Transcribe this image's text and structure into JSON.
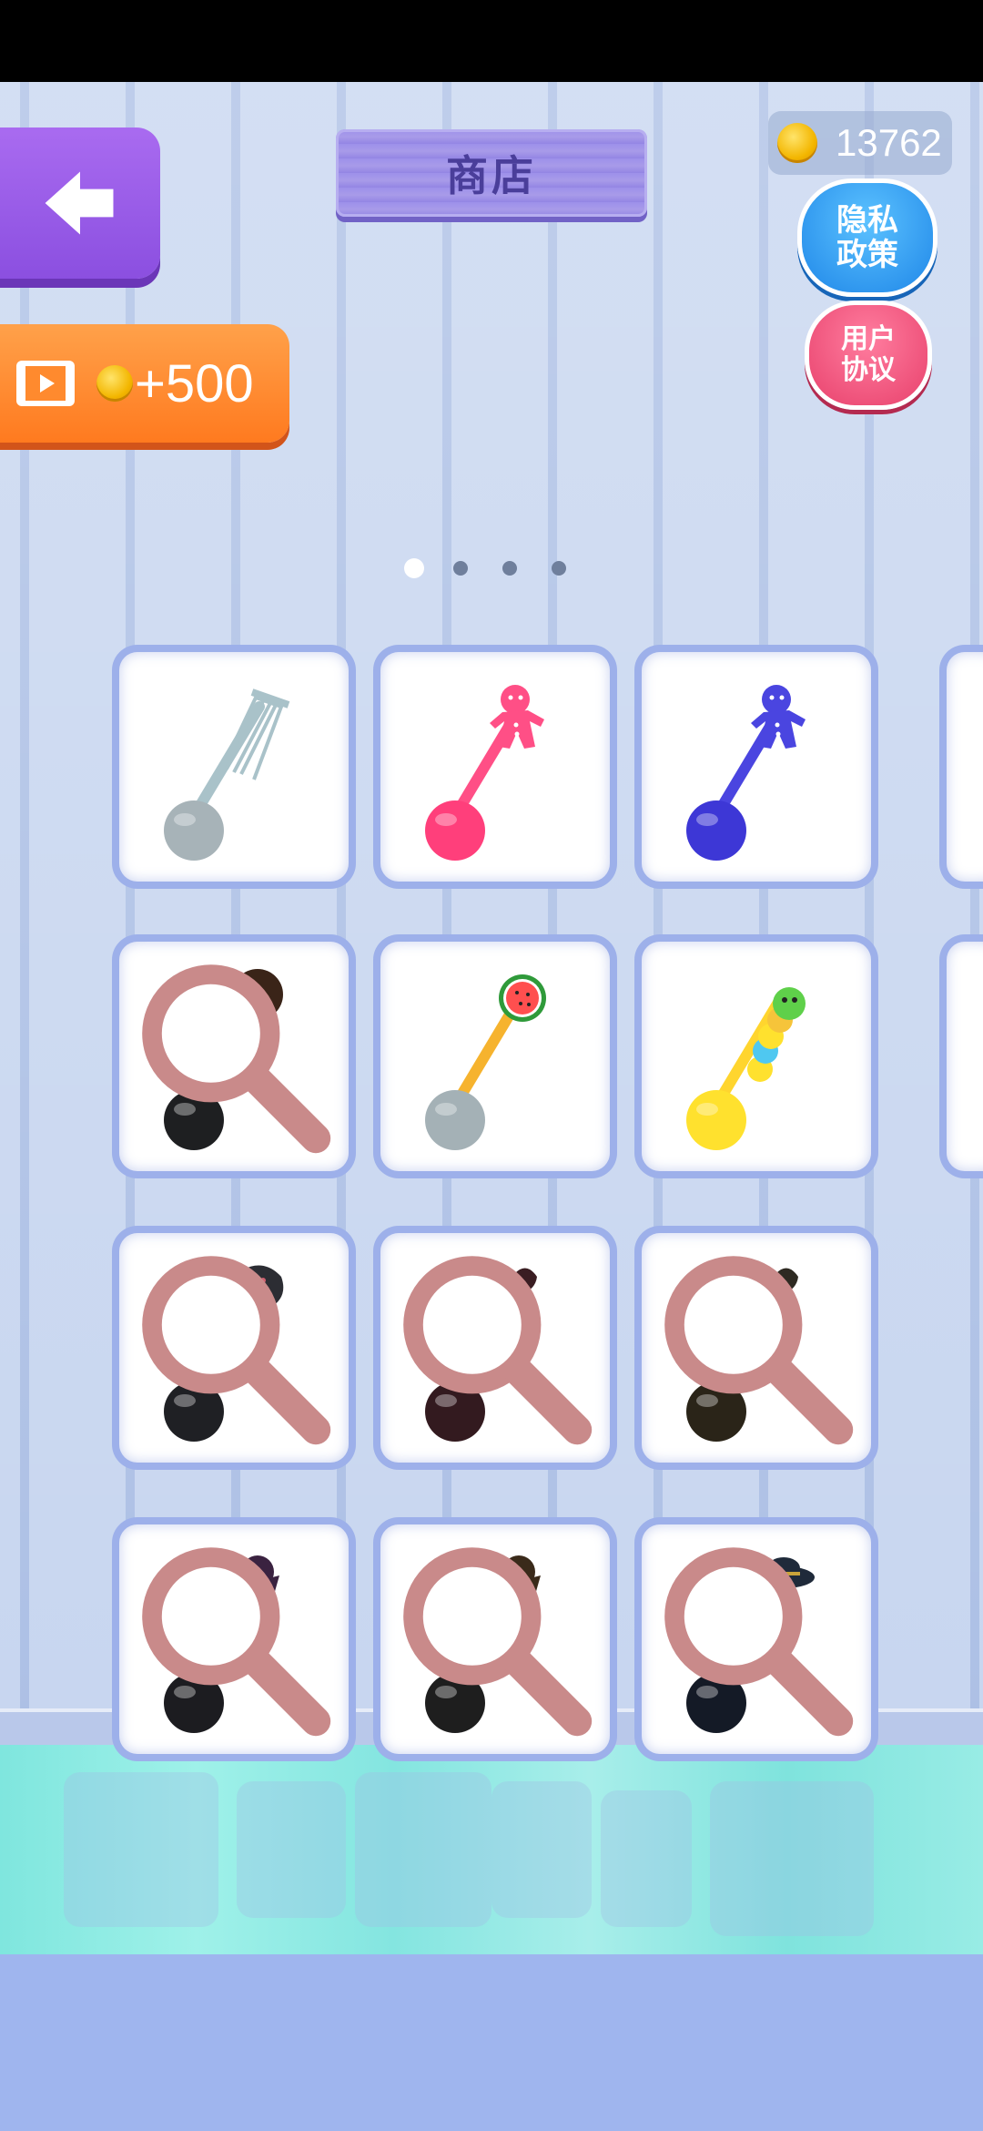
{
  "header": {
    "title": "商店",
    "coins": "13762",
    "privacy_label": "隐私政策",
    "agreement_label": "用户协议",
    "reward_label": "+500",
    "back_icon": "arrow-left-icon"
  },
  "pager": {
    "count": 4,
    "active": 0
  },
  "colors": {
    "accent": "#8b4fe0",
    "reward": "#ff7a1f",
    "privacy": "#1f87e8",
    "agreement": "#e8416c"
  },
  "items": [
    {
      "name": "whisk-scoop",
      "handle": "#a9c2c9",
      "ball": "#a7b3b8",
      "topper": "whisk",
      "locked": false
    },
    {
      "name": "gingerbread-pink-scoop",
      "handle": "#ff4f86",
      "ball": "#ff3f7b",
      "topper": "gingerbread",
      "locked": false
    },
    {
      "name": "gingerbread-blue-scoop",
      "handle": "#4a45e0",
      "ball": "#3d37d6",
      "topper": "gingerbread",
      "locked": false
    },
    {
      "name": "cookie-scoop",
      "handle": "#1f3a1c",
      "ball": "#1e1f21",
      "topper": "cookie",
      "locked": true
    },
    {
      "name": "watermelon-scoop",
      "handle": "#f6b32e",
      "ball": "#a4b1b6",
      "topper": "watermelon",
      "locked": false
    },
    {
      "name": "caterpillar-scoop",
      "handle": "#ffd52e",
      "ball": "#ffe12e",
      "topper": "caterpillar",
      "locked": false
    },
    {
      "name": "blob-scoop",
      "handle": "#2c2d33",
      "ball": "#1f2024",
      "topper": "blob",
      "locked": true
    },
    {
      "name": "drip-red-scoop",
      "handle": "#3a1d22",
      "ball": "#331a1f",
      "topper": "drip",
      "locked": true
    },
    {
      "name": "drip-brown-scoop",
      "handle": "#2e2a22",
      "ball": "#2a2418",
      "topper": "drip",
      "locked": true
    },
    {
      "name": "cone-purple-scoop",
      "handle": "#2a2a30",
      "ball": "#1c1c20",
      "topper": "cone",
      "locked": true
    },
    {
      "name": "cone-brown-scoop",
      "handle": "#2c2a28",
      "ball": "#1e1e1e",
      "topper": "cone",
      "locked": true
    },
    {
      "name": "hat-scoop",
      "handle": "#1c2233",
      "ball": "#141a26",
      "topper": "hat",
      "locked": true
    }
  ]
}
